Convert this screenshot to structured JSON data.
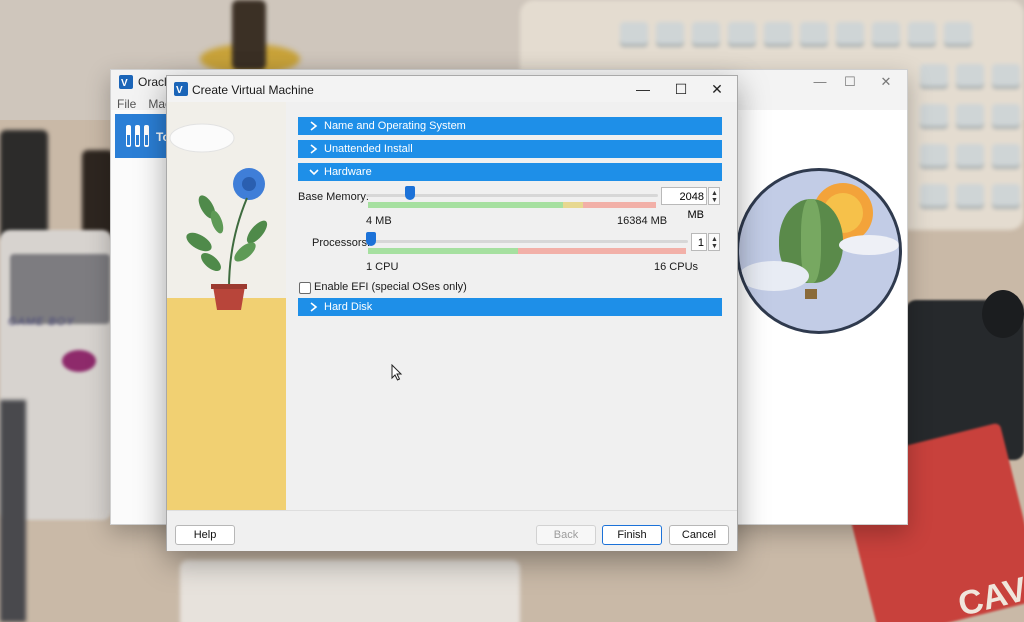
{
  "main_window": {
    "title": "Oracle",
    "menu": [
      "File",
      "Mach"
    ],
    "tools_label": "To"
  },
  "dialog": {
    "title": "Create Virtual Machine",
    "sections": {
      "name_os": "Name and Operating System",
      "unattended": "Unattended Install",
      "hardware": "Hardware",
      "hard_disk": "Hard Disk"
    },
    "base_memory": {
      "label": "Base Memory:",
      "value": "2048 MB",
      "min_label": "4 MB",
      "max_label": "16384 MB",
      "fraction": 0.125
    },
    "processors": {
      "label": "Processors:",
      "value": "1",
      "min_label": "1 CPU",
      "max_label": "16 CPUs",
      "fraction": 0.0
    },
    "efi": {
      "label": "Enable EFI (special OSes only)",
      "checked": false
    },
    "buttons": {
      "help": "Help",
      "back": "Back",
      "finish": "Finish",
      "cancel": "Cancel"
    }
  },
  "background": {
    "gameboy_text": "GAME BOY",
    "cartridge_text": "CAV"
  },
  "colors": {
    "accent": "#1e8fe8",
    "thumb": "#1c72d8",
    "scale_green": "#a6e0a0",
    "scale_red": "#f2b0a8"
  }
}
